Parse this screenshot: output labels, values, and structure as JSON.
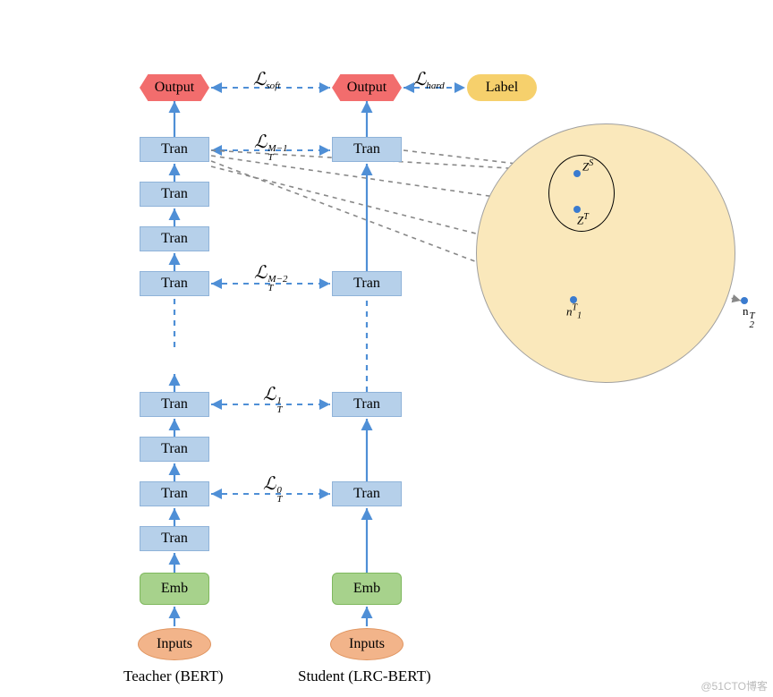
{
  "teacher": {
    "footer": "Teacher (BERT)",
    "inputs": "Inputs",
    "emb": "Emb",
    "layers": [
      "Tran",
      "Tran",
      "Tran",
      "Tran",
      "Tran",
      "Tran",
      "Tran"
    ],
    "output": "Output"
  },
  "student": {
    "footer": "Student (LRC-BERT)",
    "inputs": "Inputs",
    "emb": "Emb",
    "layers": [
      "Tran",
      "Tran",
      "Tran",
      "Tran"
    ],
    "output": "Output"
  },
  "label_box": "Label",
  "losses": {
    "soft": "soft",
    "hard": "hard",
    "t0_sup": "0",
    "t1_sup": "1",
    "tm2_sup": "M−2",
    "tm1_sup": "M−1",
    "sub": "T"
  },
  "bubble": {
    "zs": "Z",
    "zs_sup": "S",
    "zt": "Z",
    "zt_sup": "T",
    "n1": "n",
    "n1_sub": "1",
    "n1_sup": "T",
    "n2": "n",
    "n2_sub": "2",
    "n2_sup": "T"
  },
  "watermark": "@51CTO博客"
}
